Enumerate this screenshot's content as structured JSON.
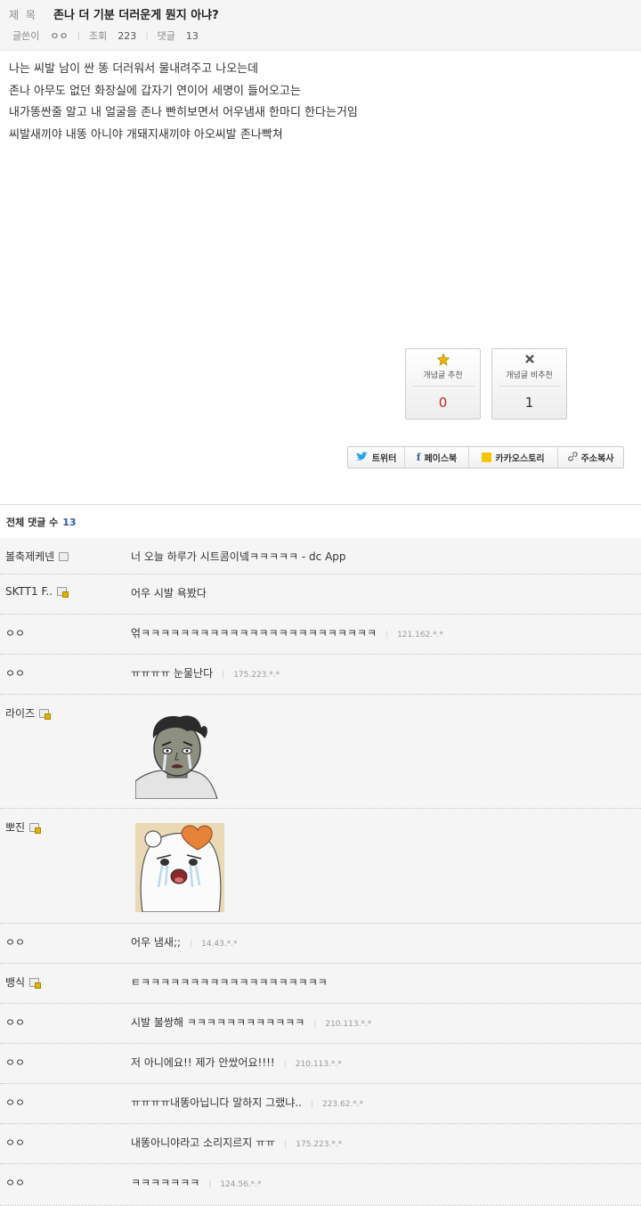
{
  "post": {
    "title_label": "제 목",
    "title": "존나 더 기분 더러운게 뭔지 아냐?",
    "author_label": "글쓴이",
    "author": "ㅇㅇ",
    "views_label": "조회",
    "views": "223",
    "comments_label": "댓글",
    "comments": "13",
    "body": [
      "나는 씨발 남이 싼 똥 더러워서 물내려주고 나오는데",
      "존나 아무도 없던 화장실에 갑자기 연이어 세명이 들어오고는",
      "내가똥싼줄 알고 내 얼굴을 존나 빤히보면서 어우냄새 한마디 한다는거임",
      "씨발새끼야 내똥 아니야 개돼지새끼야 아오씨발 존나빡쳐"
    ]
  },
  "votes": {
    "up_label": "개념글 추천",
    "up_count": "0",
    "down_label": "개념글 비추천",
    "down_count": "1",
    "up_icon": "star-award-icon",
    "down_icon": "x-icon"
  },
  "share": [
    {
      "label": "트위터",
      "icon": "twitter-icon"
    },
    {
      "label": "페이스북",
      "icon": "facebook-icon"
    },
    {
      "label": "카카오스토리",
      "icon": "kakaostory-icon"
    },
    {
      "label": "주소복사",
      "icon": "link-icon"
    }
  ],
  "comments_header": {
    "label": "전체 댓글 수",
    "count": "13"
  },
  "comments": [
    {
      "author": "볼축제케넨",
      "text": "너 오늘 하루가 시트콤이넼ㅋㅋㅋㅋㅋ - dc App",
      "ip": ""
    },
    {
      "author": "SKTT1 F..",
      "text": "어우 시발 욕봤다",
      "ip": ""
    },
    {
      "author": "ㅇㅇ",
      "text": "얶ㅋㅋㅋㅋㅋㅋㅋㅋㅋㅋㅋㅋㅋㅋㅋㅋㅋㅋㅋㅋㅋㅋㅋㅋ",
      "ip": "121.162.*.*"
    },
    {
      "author": "ㅇㅇ",
      "text": "ㅠㅠㅠㅠ 눈물난다",
      "ip": "175.223.*.*"
    },
    {
      "author": "라이즈",
      "text": "",
      "ip": ""
    },
    {
      "author": "뽀진",
      "text": "",
      "ip": ""
    },
    {
      "author": "ㅇㅇ",
      "text": "어우 냄새;;",
      "ip": "14.43.*.*"
    },
    {
      "author": "뱅식",
      "text": "ㅌㅋㅋㅋㅋㅋㅋㅋㅋㅋㅋㅋㅋㅋㅋㅋㅋㅋㅋㅋ",
      "ip": ""
    },
    {
      "author": "ㅇㅇ",
      "text": "시발 불쌍해 ㅋㅋㅋㅋㅋㅋㅋㅋㅋㅋㅋㅋ",
      "ip": "210.113.*.*"
    },
    {
      "author": "ㅇㅇ",
      "text": "저 아니에요!! 제가 안쌌어요!!!!",
      "ip": "210.113.*.*"
    },
    {
      "author": "ㅇㅇ",
      "text": "ㅠㅠㅠㅠ내똥아닙니다 말하지 그랬냐..",
      "ip": "223.62.*.*"
    },
    {
      "author": "ㅇㅇ",
      "text": "내똥아니야라고 소리지르지 ㅠㅠ",
      "ip": "175.223.*.*"
    },
    {
      "author": "ㅇㅇ",
      "text": "ㅋㅋㅋㅋㅋㅋㅋ",
      "ip": "124.56.*.*"
    }
  ]
}
